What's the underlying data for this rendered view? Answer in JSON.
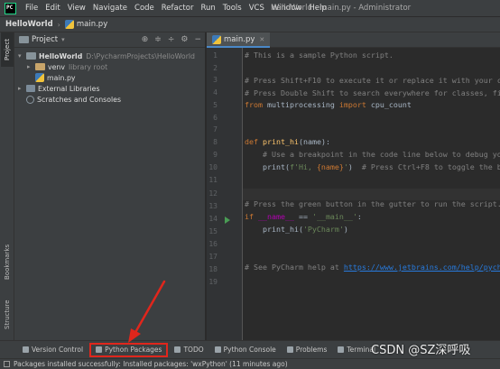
{
  "menubar": {
    "logo": "PC",
    "items": [
      "File",
      "Edit",
      "View",
      "Navigate",
      "Code",
      "Refactor",
      "Run",
      "Tools",
      "VCS",
      "Window",
      "Help"
    ],
    "window_title": "HelloWorld - main.py - Administrator"
  },
  "navbar": {
    "project": "HelloWorld",
    "file": "main.py"
  },
  "left_strip": {
    "project_tab": "Project",
    "bookmarks_tab": "Bookmarks",
    "structure_tab": "Structure"
  },
  "project_panel": {
    "title": "Project",
    "tree": {
      "root_name": "HelloWorld",
      "root_path": "D:\\PycharmProjects\\HelloWorld",
      "venv_name": "venv",
      "venv_note": "library root",
      "main_file": "main.py",
      "external_libraries": "External Libraries",
      "scratches": "Scratches and Consoles"
    }
  },
  "editor": {
    "tab_label": "main.py",
    "line_numbers": [
      "1",
      "2",
      "3",
      "4",
      "5",
      "6",
      "7",
      "8",
      "9",
      "10",
      "11",
      "12",
      "13",
      "14",
      "15",
      "16",
      "17",
      "18",
      "19"
    ]
  },
  "toolbar": {
    "version_control": "Version Control",
    "python_packages": "Python Packages",
    "todo": "TODO",
    "python_console": "Python Console",
    "problems": "Problems",
    "terminal": "Terminal"
  },
  "statusbar": {
    "message": "Packages installed successfully: Installed packages: 'wxPython' (11 minutes ago)"
  },
  "watermark": "CSDN @SZ深呼吸",
  "colors": {
    "highlight_box": "#e0261c",
    "background": "#2b2b2b",
    "panel": "#3c3f41"
  }
}
